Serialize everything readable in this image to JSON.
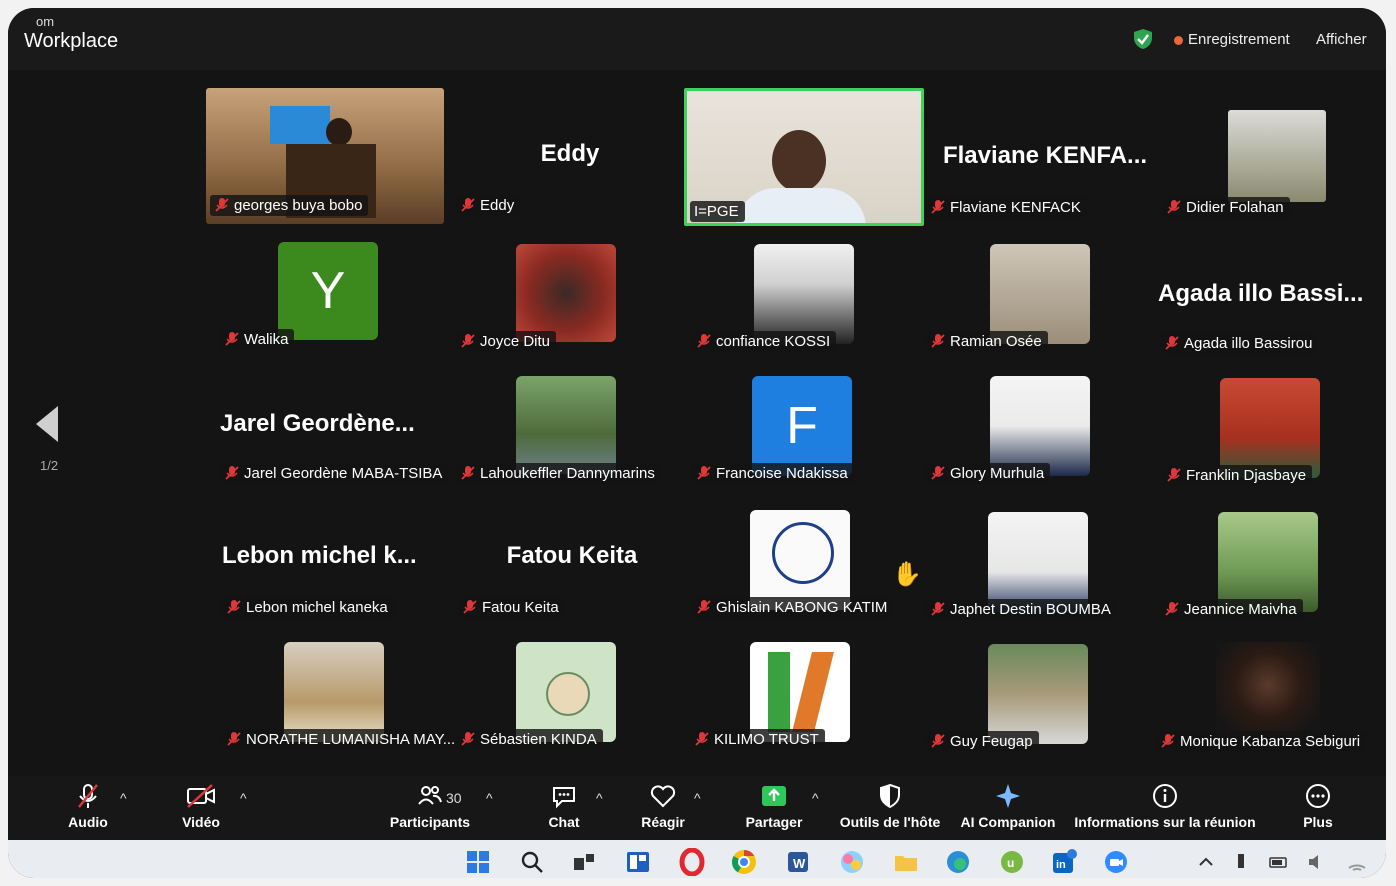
{
  "titlebar": {
    "app_small": "om",
    "app_name": "Workplace",
    "recording": "Enregistrement",
    "view": "Afficher"
  },
  "pager": {
    "page": "1/2"
  },
  "tiles": [
    {
      "name": "georges buya bobo"
    },
    {
      "name": "Eddy",
      "big": "Eddy"
    },
    {
      "name": "I=PGE"
    },
    {
      "name": "Flaviane KENFACK",
      "big": "Flaviane  KENFA..."
    },
    {
      "name": "Didier Folahan"
    },
    {
      "name": "Walika",
      "letter": "Y"
    },
    {
      "name": "Joyce Ditu"
    },
    {
      "name": "confiance KOSSI"
    },
    {
      "name": "Ramian Osée"
    },
    {
      "name": "Agada illo Bassirou",
      "big": "Agada illo Bassi..."
    },
    {
      "name": "Jarel Geordène MABA-TSIBA",
      "big": "Jarel  Geordène..."
    },
    {
      "name": "Lahoukeffler Dannymarins"
    },
    {
      "name": "Francoise Ndakissa",
      "letter": "F"
    },
    {
      "name": "Glory Murhula"
    },
    {
      "name": "Franklin Djasbaye"
    },
    {
      "name": "Lebon michel kaneka",
      "big": "Lebon michel k..."
    },
    {
      "name": "Fatou Keita",
      "big": "Fatou Keita"
    },
    {
      "name": "Ghislain KABONG KATIM"
    },
    {
      "name": "Japhet Destin BOUMBA"
    },
    {
      "name": "Jeannice Maivha"
    },
    {
      "name": "NORATHE LUMANISHA MAY..."
    },
    {
      "name": "Sébastien KINDA"
    },
    {
      "name": "KILIMO TRUST"
    },
    {
      "name": "Guy Feugap"
    },
    {
      "name": "Monique Kabanza Sebiguri"
    }
  ],
  "toolbar": {
    "audio": "Audio",
    "video": "Vidéo",
    "participants": "Participants",
    "participants_count": "30",
    "chat": "Chat",
    "react": "Réagir",
    "share": "Partager",
    "host_tools": "Outils de l'hôte",
    "ai": "AI Companion",
    "info": "Informations sur la réunion",
    "more": "Plus"
  },
  "colors": {
    "accent_green": "#3fd15a",
    "muted_red": "#e0383a",
    "bg": "#141414"
  }
}
